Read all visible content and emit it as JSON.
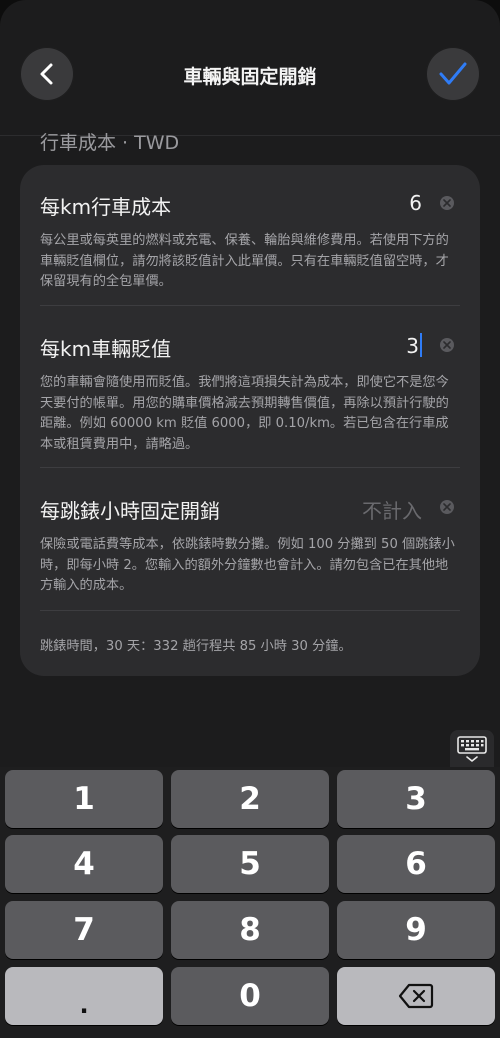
{
  "nav": {
    "title": "車輛與固定開銷",
    "back_icon": "chevron-left-icon",
    "done_icon": "checkmark-icon",
    "accent": "#2f7cf6"
  },
  "section": {
    "label": "行車成本 · TWD"
  },
  "rows": [
    {
      "title": "每km行車成本",
      "value": "6",
      "description": "每公里或每英里的燃料或充電、保養、輪胎與維修費用。若使用下方的車輛貶值欄位，請勿將該貶值計入此單價。只有在車輛貶值留空時，才保留現有的全包單價。"
    },
    {
      "title": "每km車輛貶值",
      "value": "3",
      "description": "您的車輛會隨使用而貶值。我們將這項損失計為成本，即使它不是您今天要付的帳單。用您的購車價格減去預期轉售價值，再除以預計行駛的距離。例如 60000 km 貶值 6000，即 0.10/km。若已包含在行車成本或租賃費用中，請略過。"
    },
    {
      "title": "每跳錶小時固定開銷",
      "placeholder": "不計入",
      "description": "保險或電話費等成本，依跳錶時數分攤。例如 100 分攤到 50 個跳錶小時，即每小時 2。您輸入的額外分鐘數也會計入。請勿包含已在其他地方輸入的成本。"
    }
  ],
  "footer": {
    "note": "跳錶時間，30 天：332 趟行程共 85 小時 30 分鐘。"
  },
  "keyboard": {
    "toggle_icon": "keyboard-dismiss-icon",
    "keys": [
      "1",
      "2",
      "3",
      "4",
      "5",
      "6",
      "7",
      "8",
      "9",
      ".",
      "0"
    ],
    "delete_icon": "backspace-icon"
  }
}
